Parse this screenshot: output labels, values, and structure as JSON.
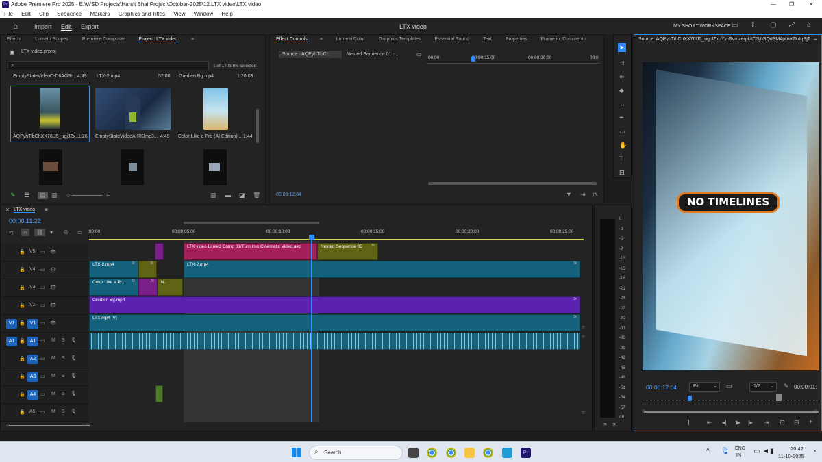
{
  "window": {
    "title": "Adobe Premiere Pro 2025 - E:\\WSD Projects\\Harsit Bhai Project\\October-2025\\12.LTX video\\LTX video",
    "controls": [
      "—",
      "❐",
      "✕"
    ]
  },
  "menu": [
    "File",
    "Edit",
    "Clip",
    "Sequence",
    "Markers",
    "Graphics and Titles",
    "View",
    "Window",
    "Help"
  ],
  "header": {
    "tabs": [
      "Import",
      "Edit",
      "Export"
    ],
    "active": "Edit",
    "project_name": "LTX video",
    "workspace": "MY SHORT WORKSPACE"
  },
  "project_panel": {
    "tabs": [
      "Effects",
      "Lumetri Scopes",
      "Premiere Composer",
      "Project: LTX video"
    ],
    "active_tab": "Project: LTX video",
    "file": "LTX video.prproj",
    "selection_info": "1 of 17 items selected",
    "search_placeholder": "",
    "top_row": [
      {
        "name": "EmptyStateVideoC-D6AG3n...",
        "duration": "4:49"
      },
      {
        "name": "LTX-2.mp4",
        "duration": "52;00"
      },
      {
        "name": "Gredien Bg.mp4",
        "duration": "1:20:03"
      }
    ],
    "items": [
      {
        "name": "AQPyhTibChXX76lJ5_ugjJZx...",
        "duration": "1:26"
      },
      {
        "name": "EmptyStateVideoA-RKlmp3...",
        "duration": "4:49"
      },
      {
        "name": "Color Like a Pro (AI Edition) ...",
        "duration": "1:44"
      }
    ]
  },
  "effect_panel": {
    "tabs": [
      "Effect Controls",
      "Lumetri Color",
      "Graphics Templates",
      "Essential Sound",
      "Text",
      "Properties",
      "Frame.io: Comments"
    ],
    "active_tab": "Effect Controls",
    "source_tab": "Source · AQPyhTibC...",
    "sequence_tab": "Nested Sequence 01 - ...",
    "ruler": [
      "00:00",
      "00:00:15:00",
      "00:00:30:00",
      "00:0"
    ],
    "timecode": "00:00:12:04"
  },
  "source_monitor": {
    "title": "Source: AQPyhTibChXX76lJ5_ugjJZxoYyrGvmzerpktlCSjbSQdSM4pbkxZkdqSjT-AVX(",
    "overlay_text": "NO TIMELINES",
    "timecode": "00:00:12:04",
    "fit": "Fit",
    "resolution": "1/2",
    "end_time": "00:00:01:"
  },
  "timeline": {
    "name": "LTX video",
    "timecode": "00:00:11:22",
    "ruler": [
      ":00:00",
      "00:00:05:00",
      "00:00:10:00",
      "00:00:15:00",
      "00:00:20:00",
      "00:00:25:00"
    ],
    "video_tracks": [
      {
        "id": "V5",
        "clips": [
          {
            "label": "LTX video Linked Comp 01/Turn into Cinematic Video.aep",
            "color": "#a4205a"
          },
          {
            "label": "Nested Sequence 05",
            "color": "#5f6415"
          }
        ]
      },
      {
        "id": "V4",
        "clips": [
          {
            "label": "LTX-2.mp4",
            "color": "#14617b"
          },
          {
            "label": "LTX-2.mp4",
            "color": "#14617b"
          }
        ]
      },
      {
        "id": "V3",
        "clips": [
          {
            "label": "Color Like a Pr...",
            "color": "#14617b"
          },
          {
            "label": "N..",
            "color": "#5f6415"
          }
        ]
      },
      {
        "id": "V2",
        "clips": [
          {
            "label": "Gredien Bg.mp4",
            "color": "#5b22b0"
          }
        ]
      },
      {
        "id": "V1",
        "clips": [
          {
            "label": "LTX.mp4 [V]",
            "color": "#14617b"
          }
        ]
      }
    ],
    "audio_tracks": [
      "A1",
      "A2",
      "A3",
      "A4",
      "A5"
    ],
    "meter_labels": [
      "0",
      "-3",
      "-6",
      "-9",
      "-12",
      "-15",
      "-18",
      "-21",
      "-24",
      "-27",
      "-30",
      "-33",
      "-36",
      "-39",
      "-42",
      "-45",
      "-48",
      "-51",
      "-54",
      "-57",
      "dB"
    ],
    "track_buttons": {
      "mute": "M",
      "solo": "S"
    }
  },
  "taskbar": {
    "search": "Search",
    "language": "ENG",
    "region": "IN",
    "time": "20:42",
    "date": "11-10-2025"
  },
  "colors": {
    "accent": "#2f8cff",
    "v5": "#a4205a",
    "nested": "#5f6415",
    "video": "#14617b",
    "gradient": "#5b22b0",
    "audio": "#16607a"
  }
}
